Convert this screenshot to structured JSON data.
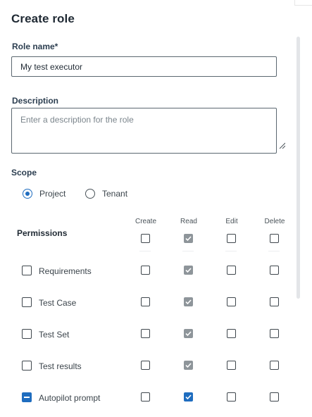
{
  "dialog": {
    "title": "Create role"
  },
  "role_name": {
    "label": "Role name*",
    "value": "My test executor"
  },
  "description": {
    "label": "Description",
    "placeholder": "Enter a description for the role",
    "value": ""
  },
  "scope": {
    "label": "Scope",
    "options": [
      {
        "label": "Project",
        "selected": true
      },
      {
        "label": "Tenant",
        "selected": false
      }
    ]
  },
  "permissions": {
    "title": "Permissions",
    "columns": [
      "Create",
      "Read",
      "Edit",
      "Delete"
    ],
    "header_checks": {
      "create": false,
      "read": "grey",
      "edit": false,
      "delete": false
    },
    "rows": [
      {
        "label": "Requirements",
        "row_state": "unchecked",
        "create": false,
        "read": "grey",
        "edit": false,
        "delete": false
      },
      {
        "label": "Test Case",
        "row_state": "unchecked",
        "create": false,
        "read": "grey",
        "edit": false,
        "delete": false
      },
      {
        "label": "Test Set",
        "row_state": "unchecked",
        "create": false,
        "read": "grey",
        "edit": false,
        "delete": false
      },
      {
        "label": "Test results",
        "row_state": "unchecked",
        "create": false,
        "read": "grey",
        "edit": false,
        "delete": false
      },
      {
        "label": "Autopilot prompt",
        "row_state": "indeterminate",
        "create": false,
        "read": "blue",
        "edit": false,
        "delete": false
      }
    ]
  },
  "colors": {
    "accent": "#1f6dbf",
    "disabled_check": "#8e959a",
    "border": "#5b6770"
  }
}
